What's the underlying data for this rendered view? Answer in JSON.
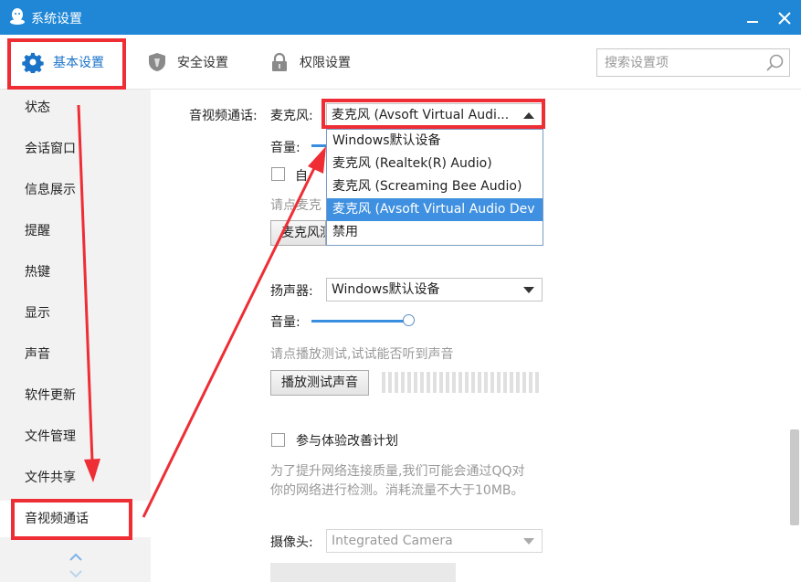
{
  "window": {
    "title": "系统设置"
  },
  "tabs": [
    {
      "label": "基本设置",
      "icon": "gear-icon"
    },
    {
      "label": "安全设置",
      "icon": "shield-icon"
    },
    {
      "label": "权限设置",
      "icon": "lock-icon"
    }
  ],
  "search": {
    "placeholder": "搜索设置项"
  },
  "sidebar": {
    "items": [
      {
        "label": "状态"
      },
      {
        "label": "会话窗口"
      },
      {
        "label": "信息展示"
      },
      {
        "label": "提醒"
      },
      {
        "label": "热键"
      },
      {
        "label": "显示"
      },
      {
        "label": "声音"
      },
      {
        "label": "软件更新"
      },
      {
        "label": "文件管理"
      },
      {
        "label": "文件共享"
      },
      {
        "label": "音视频通话"
      }
    ],
    "active": "音视频通话"
  },
  "av": {
    "section_label": "音视频通话:",
    "mic": {
      "label": "麦克风:",
      "selected": "麦克风 (Avsoft Virtual Audi...",
      "volume_label": "音量:",
      "auto_label_partial": "自",
      "hint_partial": "请点麦克",
      "test_button_partial": "麦克风测"
    },
    "mic_options": [
      "Windows默认设备",
      "麦克风 (Realtek(R) Audio)",
      "麦克风 (Screaming Bee Audio)",
      "麦克风 (Avsoft Virtual Audio Dev",
      "禁用"
    ],
    "mic_options_selected_index": 3,
    "speaker": {
      "label": "扬声器:",
      "selected": "Windows默认设备",
      "volume_label": "音量:",
      "volume_level": 0.9,
      "hint": "请点播放测试,试试能否听到声音",
      "test_button": "播放测试声音"
    },
    "experience": {
      "label": "参与体验改善计划",
      "desc_line1": "为了提升网络连接质量,我们可能会通过QQ对",
      "desc_line2": "你的网络进行检测。消耗流量不大于10MB。"
    },
    "camera": {
      "label": "摄像头:",
      "selected": "Integrated Camera"
    }
  },
  "colors": {
    "titlebar": "#1f87d6",
    "accent": "#1a73c8",
    "annotation": "#ee2d35",
    "selected_option": "#3f90e0"
  }
}
